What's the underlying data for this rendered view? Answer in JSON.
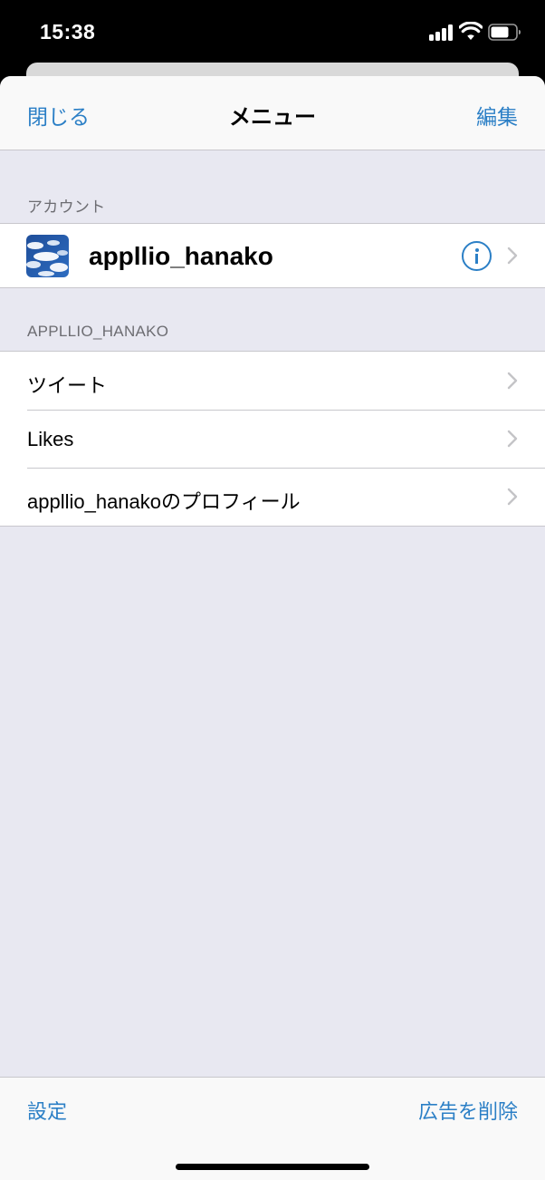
{
  "status_bar": {
    "time": "15:38"
  },
  "nav": {
    "close_label": "閉じる",
    "title": "メニュー",
    "edit_label": "編集"
  },
  "sections": {
    "account_header": "アカウント",
    "user_header": "APPLLIO_HANAKO"
  },
  "account": {
    "username": "appllio_hanako"
  },
  "menu_items": [
    {
      "label": "ツイート"
    },
    {
      "label": "Likes"
    },
    {
      "label": "appllio_hanakoのプロフィール"
    }
  ],
  "toolbar": {
    "settings_label": "設定",
    "remove_ads_label": "広告を削除"
  },
  "colors": {
    "accent": "#2b7fc6",
    "grouped_bg": "#e8e8f1",
    "separator": "#c8c7cc"
  }
}
